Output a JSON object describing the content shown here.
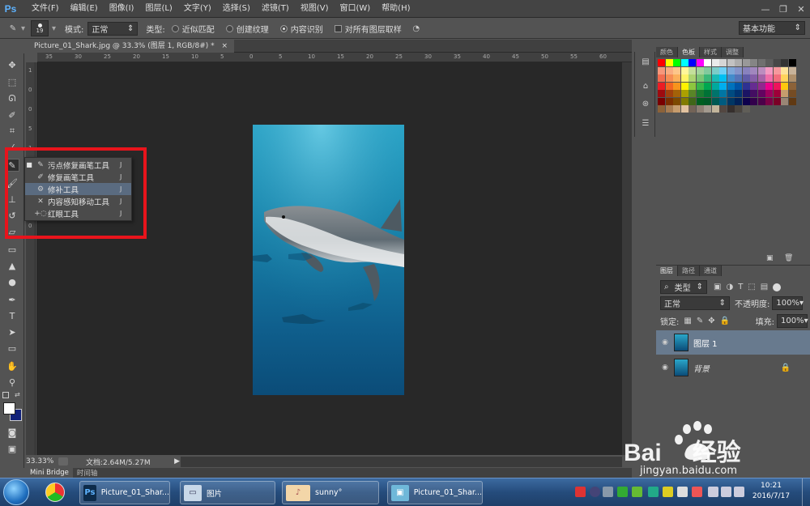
{
  "app": {
    "logo": "Ps"
  },
  "menu": [
    "文件(F)",
    "编辑(E)",
    "图像(I)",
    "图层(L)",
    "文字(Y)",
    "选择(S)",
    "滤镜(T)",
    "视图(V)",
    "窗口(W)",
    "帮助(H)"
  ],
  "options": {
    "brush_size": "19",
    "mode_label": "模式:",
    "mode_value": "正常",
    "type_label": "类型:",
    "type_options": [
      "近似匹配",
      "创建纹理",
      "内容识别"
    ],
    "type_selected": "内容识别",
    "sample_all_label": "对所有图层取样",
    "workspace": "基本功能"
  },
  "document": {
    "tab_title": "Picture_01_Shark.jpg @ 33.3% (图层 1, RGB/8#) *"
  },
  "ruler_h": [
    "35",
    "30",
    "25",
    "20",
    "15",
    "10",
    "5",
    "0",
    "5",
    "10",
    "15",
    "20",
    "25",
    "30",
    "35",
    "40",
    "45",
    "50",
    "55",
    "60"
  ],
  "ruler_v": [
    "1",
    "0",
    "0",
    "5",
    "1",
    "0",
    "5",
    "2",
    "0"
  ],
  "flyout": {
    "items": [
      {
        "label": "污点修复画笔工具",
        "key": "J",
        "icon": "spot-healing-icon",
        "active": true
      },
      {
        "label": "修复画笔工具",
        "key": "J",
        "icon": "healing-brush-icon",
        "active": false
      },
      {
        "label": "修补工具",
        "key": "J",
        "icon": "patch-icon",
        "active": false
      },
      {
        "label": "内容感知移动工具",
        "key": "J",
        "icon": "content-aware-move-icon",
        "active": false
      },
      {
        "label": "红眼工具",
        "key": "J",
        "icon": "red-eye-icon",
        "active": false
      }
    ]
  },
  "status": {
    "zoom": "33.33%",
    "doc_size": "文档:2.64M/5.27M"
  },
  "bottom_tabs": [
    "Mini Bridge",
    "时间轴"
  ],
  "swatch_panel": {
    "tabs": [
      "颜色",
      "色板",
      "样式",
      "调整"
    ],
    "active_tab": "色板"
  },
  "layers_panel": {
    "tabs": [
      "图层",
      "路径",
      "通道"
    ],
    "filter_label": "类型",
    "blend_mode": "正常",
    "opacity_label": "不透明度:",
    "opacity_value": "100%",
    "lock_label": "锁定:",
    "fill_label": "填充:",
    "fill_value": "100%",
    "layers": [
      {
        "name": "图层 1",
        "selected": true,
        "locked": false
      },
      {
        "name": "背景",
        "selected": false,
        "locked": true
      }
    ]
  },
  "taskbar": {
    "tasks": [
      {
        "label": "Picture_01_Shar...",
        "icon": "photoshop-icon"
      },
      {
        "label": "图片",
        "icon": "folder-icon"
      },
      {
        "label": "sunny°",
        "icon": "chat-icon"
      },
      {
        "label": "Picture_01_Shar...",
        "icon": "image-viewer-icon"
      }
    ],
    "time": "10:21",
    "date": "2016/7/17"
  },
  "watermark": {
    "brand": "Bai",
    "brand_cn": "经验",
    "url": "jingyan.baidu.com"
  },
  "colors": {
    "highlight": "#e8141c",
    "accent": "#5eb3ff"
  }
}
